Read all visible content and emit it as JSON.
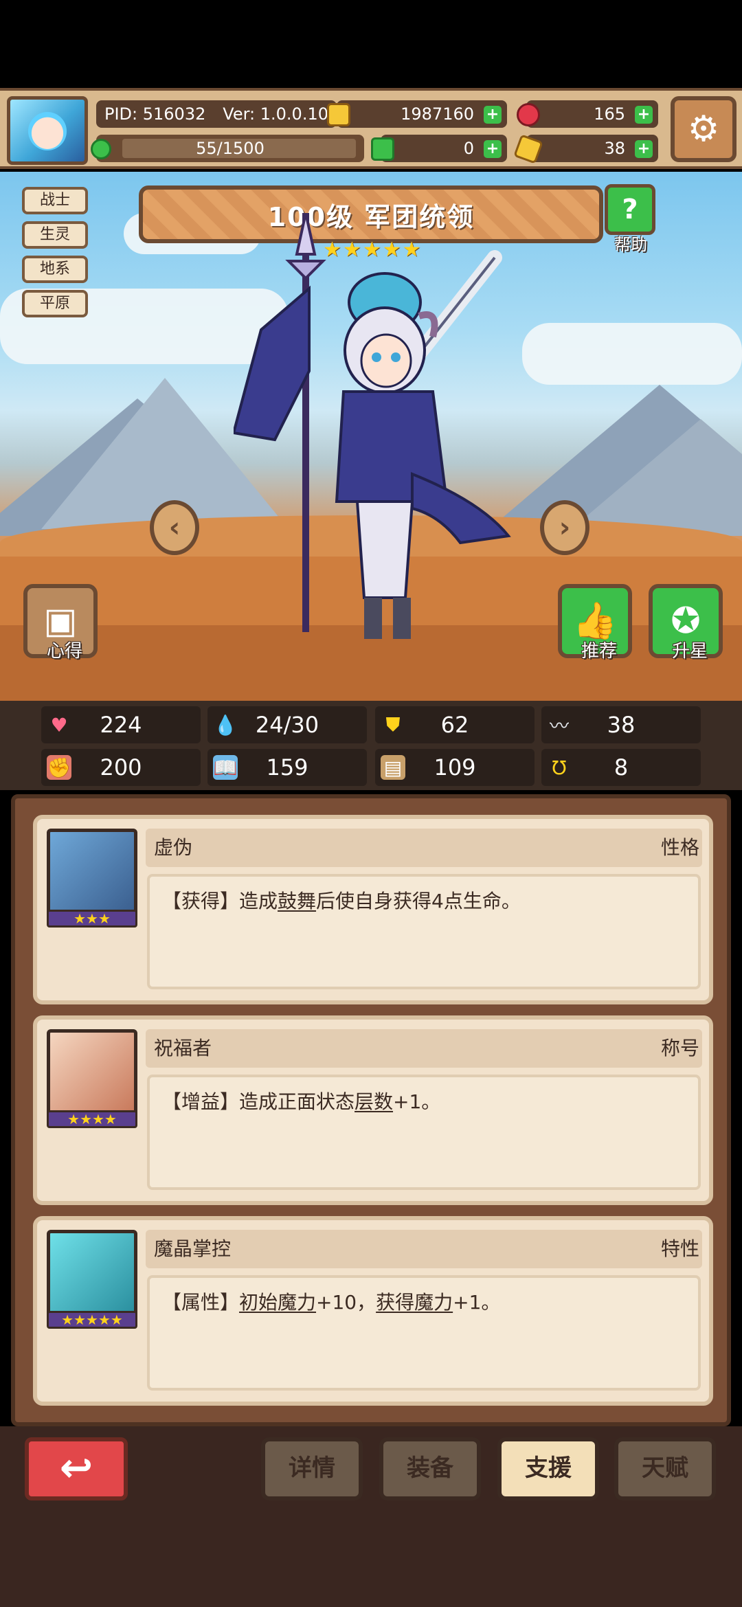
{
  "header": {
    "pid": "PID: 516032",
    "version": "Ver: 1.0.0.10",
    "exp": "55/1500",
    "gold": "1987160",
    "gems": "165",
    "clover": "0",
    "keys": "38"
  },
  "tags": [
    "战士",
    "生灵",
    "地系",
    "平原"
  ],
  "title": "100级 军团统领",
  "star_count": 5,
  "help_label": "帮助",
  "side_buttons": {
    "xinde": "心得",
    "tuijian": "推荐",
    "shengxing": "升星"
  },
  "stats": {
    "hp": "224",
    "mana": "24/30",
    "defense": "62",
    "speed": "38",
    "attack": "200",
    "magic": "159",
    "armor": "109",
    "luck": "8"
  },
  "cards": [
    {
      "name": "虚伪",
      "type": "性格",
      "stars": "★★★",
      "desc_prefix": "【获得】造成",
      "desc_link1": "鼓舞",
      "desc_suffix": "后使自身获得4点生命。"
    },
    {
      "name": "祝福者",
      "type": "称号",
      "stars": "★★★★",
      "desc_prefix": "【增益】造成正面状态",
      "desc_link1": "层数",
      "desc_suffix": "+1。"
    },
    {
      "name": "魔晶掌控",
      "type": "特性",
      "stars": "★★★★★",
      "desc_prefix": "【属性】",
      "desc_link1": "初始魔力",
      "desc_middle": "+10，",
      "desc_link2": "获得魔力",
      "desc_suffix": "+1。"
    }
  ],
  "bottom_nav": {
    "details": "详情",
    "equip": "装备",
    "support": "支援",
    "talent": "天赋"
  },
  "colors": {
    "accent_green": "#3cbf4a",
    "back_red": "#e2474a",
    "panel_brown": "#7a4e36",
    "card_bg": "#f2e2cc"
  }
}
